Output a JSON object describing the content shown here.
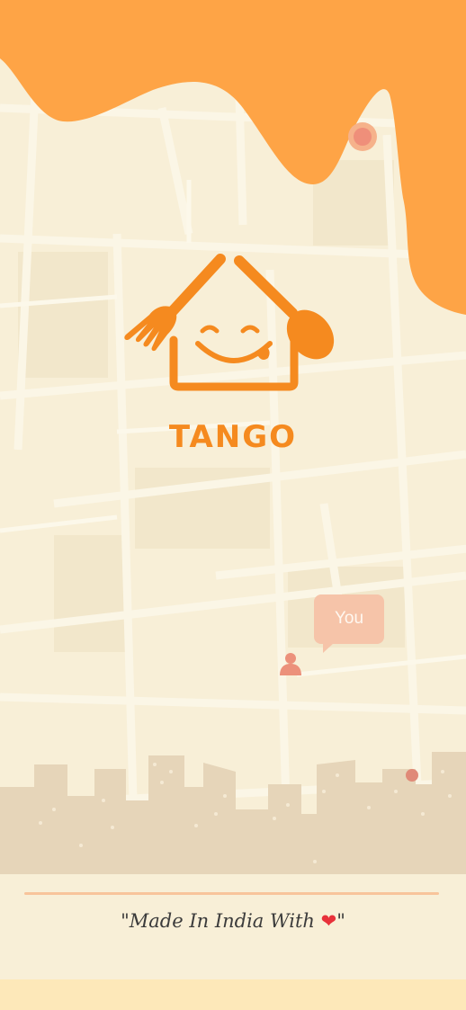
{
  "app": {
    "name": "TANGO"
  },
  "map": {
    "you_label": "You"
  },
  "footer": {
    "tagline_prefix": "\"Made In India With",
    "tagline_suffix": "\"",
    "heart_glyph": "❤"
  },
  "colors": {
    "brand_orange": "#f58a1f",
    "top_blob": "#fea446",
    "map_background": "#f8efd7",
    "map_roads": "#fbf6e6",
    "skyline": "#dfcdb1",
    "bubble": "#f6c4a9",
    "heart": "#e8313a"
  }
}
